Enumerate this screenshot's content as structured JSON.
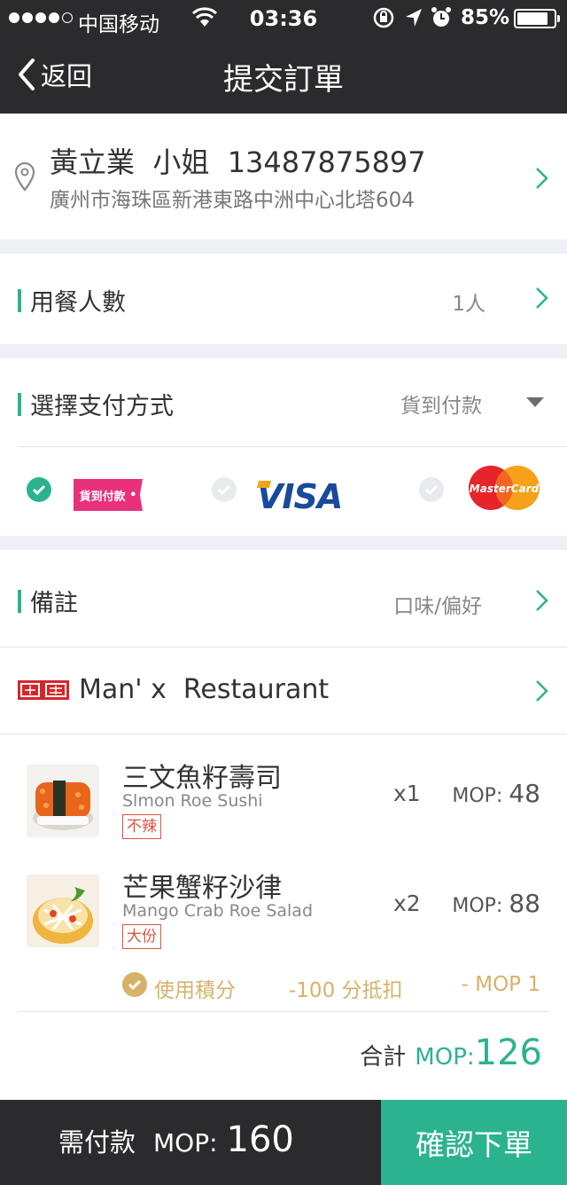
{
  "status_bar": {
    "carrier": "中国移动",
    "time": "03:36",
    "battery": "85%",
    "battery_level": 0.85
  },
  "nav": {
    "back_label": "返回",
    "title": "提交訂單"
  },
  "address": {
    "contact": "黃立業  小姐  13487875897",
    "street": "廣州市海珠區新港東路中洲中心北塔604"
  },
  "diners": {
    "label": "用餐人數",
    "value": "1人"
  },
  "payment": {
    "label": "選擇支付方式",
    "selected": "貨到付款",
    "options": [
      {
        "name": "cash-on-delivery",
        "label": "貨到付款",
        "checked": true
      },
      {
        "name": "visa",
        "label": "VISA",
        "checked": false
      },
      {
        "name": "mastercard",
        "label": "MasterCard",
        "checked": false
      }
    ]
  },
  "remarks": {
    "label": "備註",
    "value": "口味/偏好"
  },
  "restaurant": {
    "name": "Man' x  Restaurant"
  },
  "items": [
    {
      "name_cn": "三文魚籽壽司",
      "name_en": "Slmon Roe Sushi",
      "tag": "不辣",
      "qty": "x1",
      "currency": "MOP:",
      "price": "48"
    },
    {
      "name_cn": "芒果蟹籽沙律",
      "name_en": "Mango Crab Roe Salad",
      "tag": "大份",
      "qty": "x2",
      "currency": "MOP:",
      "price": "88"
    }
  ],
  "points": {
    "label": "使用積分",
    "deduction": "-100 分抵扣",
    "amount": "- MOP 1"
  },
  "total": {
    "label": "合計",
    "currency": "MOP:",
    "amount": "126"
  },
  "footer": {
    "due_label": "需付款",
    "currency": "MOP:",
    "amount": "160",
    "confirm_label": "確認下單"
  },
  "colors": {
    "accent": "#2bb38f",
    "dark": "#2b2b2d",
    "gold": "#d6b26a",
    "tag_red": "#e0533d"
  }
}
